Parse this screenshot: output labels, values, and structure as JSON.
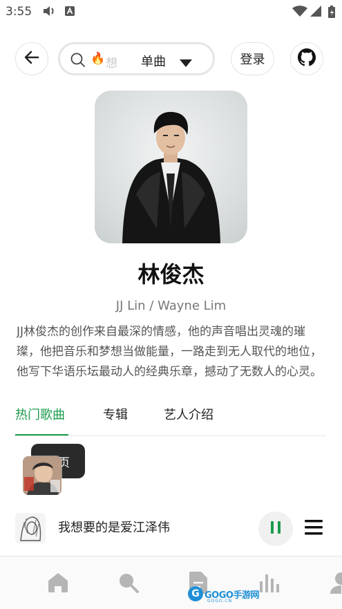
{
  "status_bar": {
    "time": "3:55"
  },
  "search": {
    "fire_emoji": "🔥",
    "placeholder": "想听",
    "type_selected": "单曲"
  },
  "header": {
    "login_label": "登录"
  },
  "artist": {
    "name": "林俊杰",
    "english_name": "JJ Lin / Wayne Lim",
    "bio": "JJ林俊杰的创作来自最深的情感，他的声音唱出灵魂的璀璨，他把音乐和梦想当做能量，一路走到无人取代的地位，他写下华语乐坛最动人的经典乐章，撼动了无数人的心灵。"
  },
  "tabs": [
    {
      "label": "热门歌曲",
      "active": true
    },
    {
      "label": "专辑",
      "active": false
    },
    {
      "label": "艺人介绍",
      "active": false
    }
  ],
  "floating": {
    "home_label": "首页"
  },
  "player": {
    "song_title": "我想要的是爱江泽伟"
  },
  "watermark": {
    "brand": "GOGO手游网",
    "domain": "GOGO.CN"
  },
  "colors": {
    "accent": "#1a9b4b",
    "pill": "#2a2a2a"
  }
}
